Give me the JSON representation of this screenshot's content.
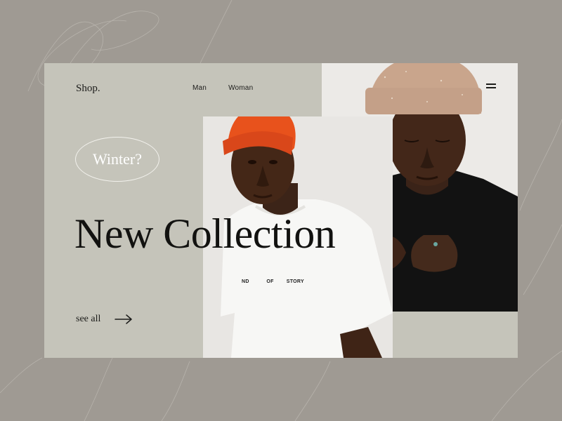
{
  "header": {
    "logo": "Shop.",
    "nav": [
      {
        "label": "Man"
      },
      {
        "label": "Woman"
      }
    ],
    "menu_icon": "hamburger-menu-icon"
  },
  "hero": {
    "badge": "Winter?",
    "headline": "New Collection",
    "cta_label": "see all",
    "cta_icon": "arrow-right-icon"
  },
  "shirt_print": {
    "word1": "ND",
    "word2": "OF",
    "word3": "STORY"
  },
  "colors": {
    "page_bg": "#9f9a93",
    "card_bg": "#c5c4ba",
    "beanie_orange": "#e8521c",
    "beanie_tan": "#c9a58c",
    "text_dark": "#121210"
  }
}
